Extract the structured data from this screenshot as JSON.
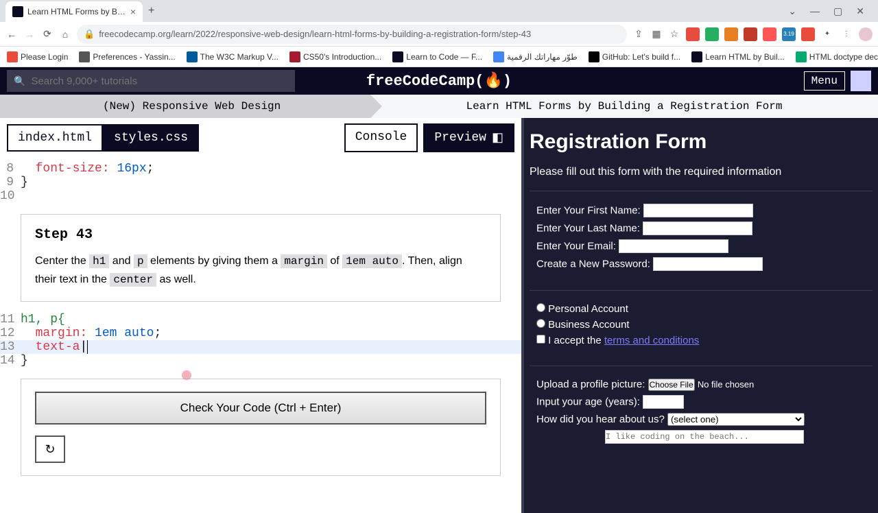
{
  "browser": {
    "tab_title": "Learn HTML Forms by Building a",
    "url": "freecodecamp.org/learn/2022/responsive-web-design/learn-html-forms-by-building-a-registration-form/step-43"
  },
  "bookmarks": [
    {
      "label": "Please Login",
      "color": "#e74c3c"
    },
    {
      "label": "Preferences - Yassin...",
      "color": "#555"
    },
    {
      "label": "The W3C Markup V...",
      "color": "#005a9c"
    },
    {
      "label": "CS50's Introduction...",
      "color": "#a51c30"
    },
    {
      "label": "Learn to Code — F...",
      "color": "#0a0a23"
    },
    {
      "label": "طوّر مهاراتك الرقمية",
      "color": "#4285f4"
    },
    {
      "label": "GitHub: Let's build f...",
      "color": "#000"
    },
    {
      "label": "Learn HTML by Buil...",
      "color": "#0a0a23"
    },
    {
      "label": "HTML doctype decl...",
      "color": "#04aa6d"
    }
  ],
  "fcc": {
    "search_placeholder": "Search 9,000+ tutorials",
    "logo": "freeCodeCamp(🔥)",
    "menu": "Menu"
  },
  "breadcrumb": {
    "left": "(New) Responsive Web Design",
    "right": "Learn HTML Forms by Building a Registration Form"
  },
  "tabs": {
    "html": "index.html",
    "css": "styles.css",
    "console": "Console",
    "preview": "Preview"
  },
  "code": {
    "l8_prop": "font-size:",
    "l8_val": " 16px",
    "l11": "h1, p{",
    "l12_prop": "margin:",
    "l12_val": " 1em auto",
    "l13": "text-a"
  },
  "instructions": {
    "title": "Step 43",
    "t1": "Center the ",
    "c1": "h1",
    "t2": " and ",
    "c2": "p",
    "t3": " elements by giving them a ",
    "c3": "margin",
    "t4": " of ",
    "c4": "1em auto",
    "t5": ". Then, align their text in the ",
    "c5": "center",
    "t6": " as well."
  },
  "check": "Check Your Code (Ctrl + Enter)",
  "preview": {
    "h1": "Registration Form",
    "sub": "Please fill out this form with the required information",
    "first": "Enter Your First Name:",
    "last": "Enter Your Last Name:",
    "email": "Enter Your Email:",
    "pw": "Create a New Password:",
    "personal": "Personal Account",
    "business": "Business Account",
    "accept": "I accept the ",
    "terms": "terms and conditions",
    "upload": "Upload a profile picture:",
    "choose": "Choose File",
    "nofile": "No file chosen",
    "age": "Input your age (years):",
    "hear": "How did you hear about us?",
    "select": "(select one)",
    "bio": "I like coding on the beach..."
  }
}
